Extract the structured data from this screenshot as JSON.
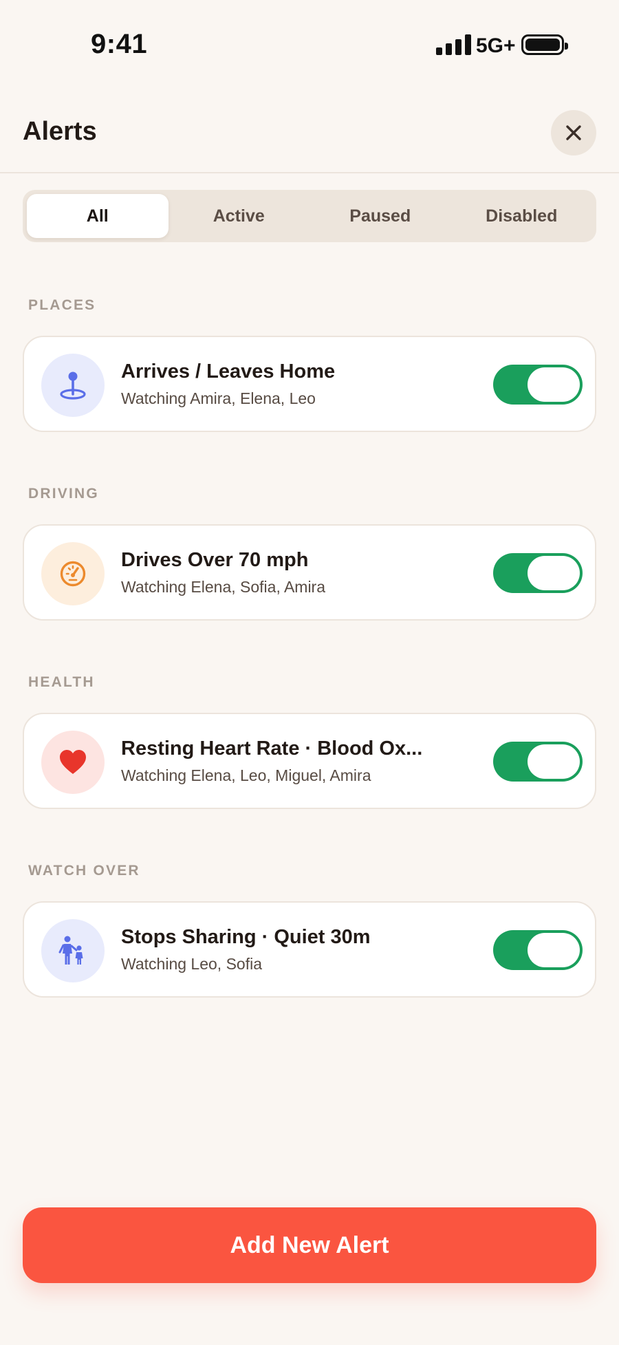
{
  "status_bar": {
    "time": "9:41",
    "network": "5G+"
  },
  "header": {
    "title": "Alerts"
  },
  "tabs": [
    {
      "label": "All",
      "active": true
    },
    {
      "label": "Active",
      "active": false
    },
    {
      "label": "Paused",
      "active": false
    },
    {
      "label": "Disabled",
      "active": false
    }
  ],
  "sections": [
    {
      "label": "PLACES",
      "alert": {
        "title": "Arrives / Leaves Home",
        "subtitle": "Watching Amira, Elena, Leo",
        "icon": "map-pin-icon",
        "icon_color": "#5a6ee8",
        "icon_bg": "#e8ebfc",
        "enabled": true
      }
    },
    {
      "label": "DRIVING",
      "alert": {
        "title": "Drives Over 70 mph",
        "subtitle": "Watching Elena, Sofia, Amira",
        "icon": "speedometer-icon",
        "icon_color": "#ec8a2d",
        "icon_bg": "#fdeedd",
        "enabled": true
      }
    },
    {
      "label": "HEALTH",
      "alert": {
        "title": "Resting Heart Rate · Blood Ox...",
        "subtitle": "Watching Elena, Leo, Miguel, Amira",
        "icon": "heart-icon",
        "icon_color": "#e8352b",
        "icon_bg": "#fde4e1",
        "enabled": true
      }
    },
    {
      "label": "WATCH OVER",
      "alert": {
        "title": "Stops Sharing · Quiet 30m",
        "subtitle": "Watching Leo, Sofia",
        "icon": "adult-child-icon",
        "icon_color": "#5a6ee8",
        "icon_bg": "#e8ebfc",
        "enabled": true
      }
    }
  ],
  "add_button": {
    "label": "Add New Alert"
  },
  "colors": {
    "accent": "#fa5540",
    "toggle_on": "#1a9f5c",
    "background": "#faf6f2"
  }
}
